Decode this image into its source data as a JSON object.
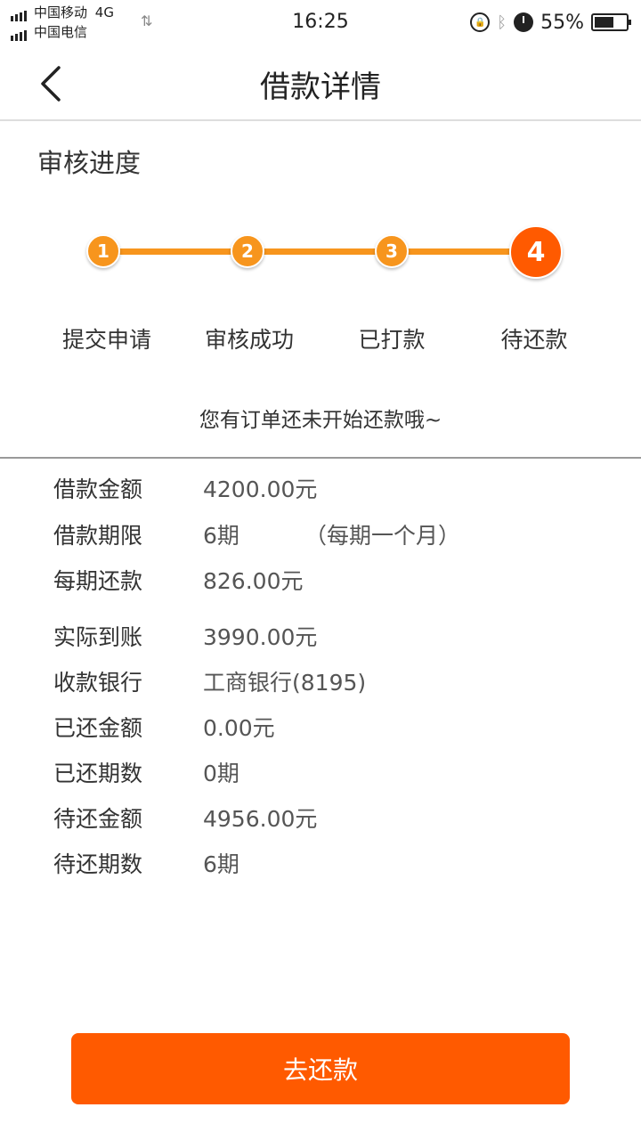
{
  "status_bar": {
    "carrier1": "中国移动",
    "network": "4G",
    "carrier2": "中国电信",
    "time": "16:25",
    "battery": "55%"
  },
  "nav": {
    "title": "借款详情"
  },
  "progress": {
    "title": "审核进度",
    "steps": [
      {
        "number": "1",
        "label": "提交申请"
      },
      {
        "number": "2",
        "label": "审核成功"
      },
      {
        "number": "3",
        "label": "已打款"
      },
      {
        "number": "4",
        "label": "待还款"
      }
    ],
    "current_step": 4,
    "notice": "您有订单还未开始还款哦~"
  },
  "details": [
    {
      "label": "借款金额",
      "value": "4200.00元"
    },
    {
      "label": "借款期限",
      "value": "6期",
      "note": "（每期一个月）"
    },
    {
      "label": "每期还款",
      "value": "826.00元"
    },
    {
      "label": "实际到账",
      "value": "3990.00元"
    },
    {
      "label": "收款银行",
      "value": "工商银行(8195)"
    },
    {
      "label": "已还金额",
      "value": "0.00元"
    },
    {
      "label": "已还期数",
      "value": "0期"
    },
    {
      "label": "待还金额",
      "value": "4956.00元"
    },
    {
      "label": "待还期数",
      "value": "6期"
    }
  ],
  "actions": {
    "pay_label": "去还款"
  },
  "colors": {
    "accent": "#f7951d",
    "active": "#ff5a00"
  }
}
